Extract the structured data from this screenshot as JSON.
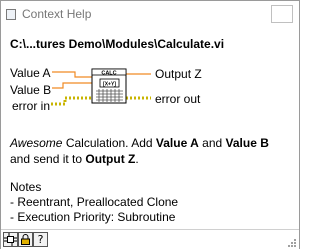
{
  "window": {
    "title": "Context Help"
  },
  "help": {
    "vi_path": "C:\\...tures Demo\\Modules\\Calculate.vi",
    "diagram": {
      "icon_title": "CALC",
      "icon_sub": "[X+Y]",
      "inputs": [
        "Value A",
        "Value B",
        "error in"
      ],
      "outputs": [
        "Output Z",
        "error out"
      ],
      "wire_colors": {
        "numeric": "#f08a24",
        "error": "#c8b400"
      }
    },
    "description": {
      "part1_italic": "Awesome",
      "part2": " Calculation. Add ",
      "part3_bold": "Value A",
      "part4": " and ",
      "part5_bold": "Value B",
      "part6": " and send it to ",
      "part7_bold": "Output Z",
      "part8": "."
    },
    "notes": {
      "heading": "Notes",
      "items": [
        "- Reentrant, Preallocated Clone",
        "- Execution Priority: Subroutine"
      ]
    }
  },
  "toolbar": {
    "buttons": [
      {
        "icon": "show-optional-terminals-icon"
      },
      {
        "icon": "lock-icon"
      },
      {
        "label": "?",
        "icon": "detailed-help-icon"
      }
    ]
  }
}
